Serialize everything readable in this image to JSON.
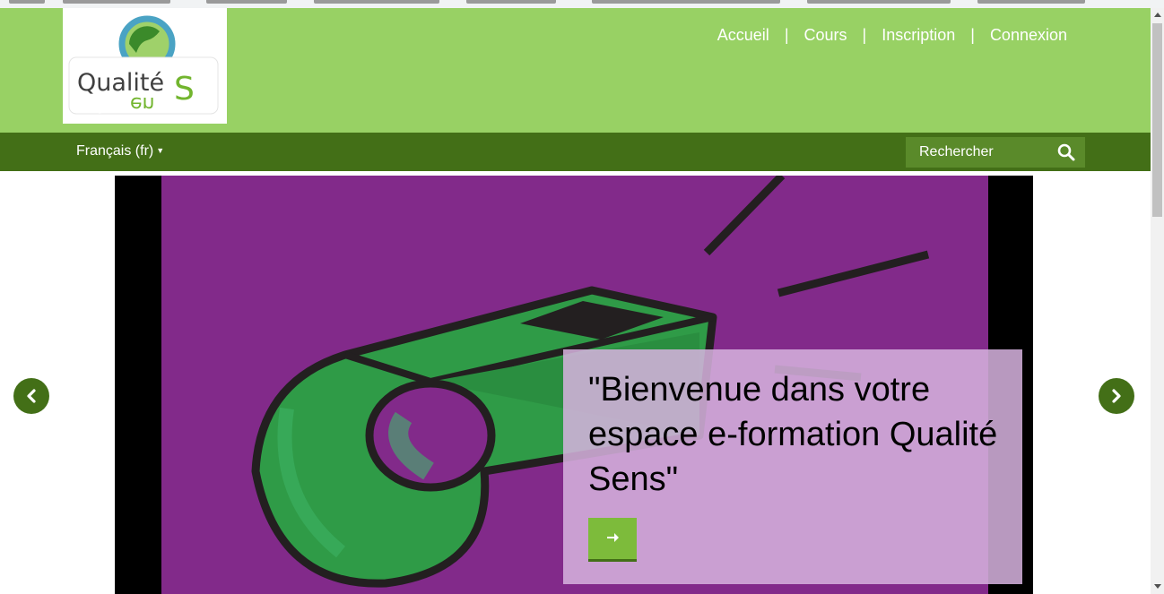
{
  "header": {
    "logo_text_top": "Qualité",
    "logo_text_bottom": "Sens",
    "nav": [
      {
        "label": "Accueil"
      },
      {
        "label": "Cours"
      },
      {
        "label": "Inscription"
      },
      {
        "label": "Connexion"
      }
    ],
    "separator": "|"
  },
  "subnav": {
    "language": "Français (fr)",
    "search_placeholder": "Rechercher"
  },
  "carousel": {
    "caption": "\"Bienvenue dans votre espace e-formation Qualité Sens\""
  },
  "icons": {
    "search": "search-icon",
    "arrow_right": "arrow-right-icon",
    "prev": "chevron-left-icon",
    "next": "chevron-right-icon"
  },
  "colors": {
    "header_bg": "#98d164",
    "subnav_bg": "#436f17",
    "accent": "#7dbb3b",
    "slide_bg": "#822a8a",
    "caption_bg": "#d6b2de"
  }
}
